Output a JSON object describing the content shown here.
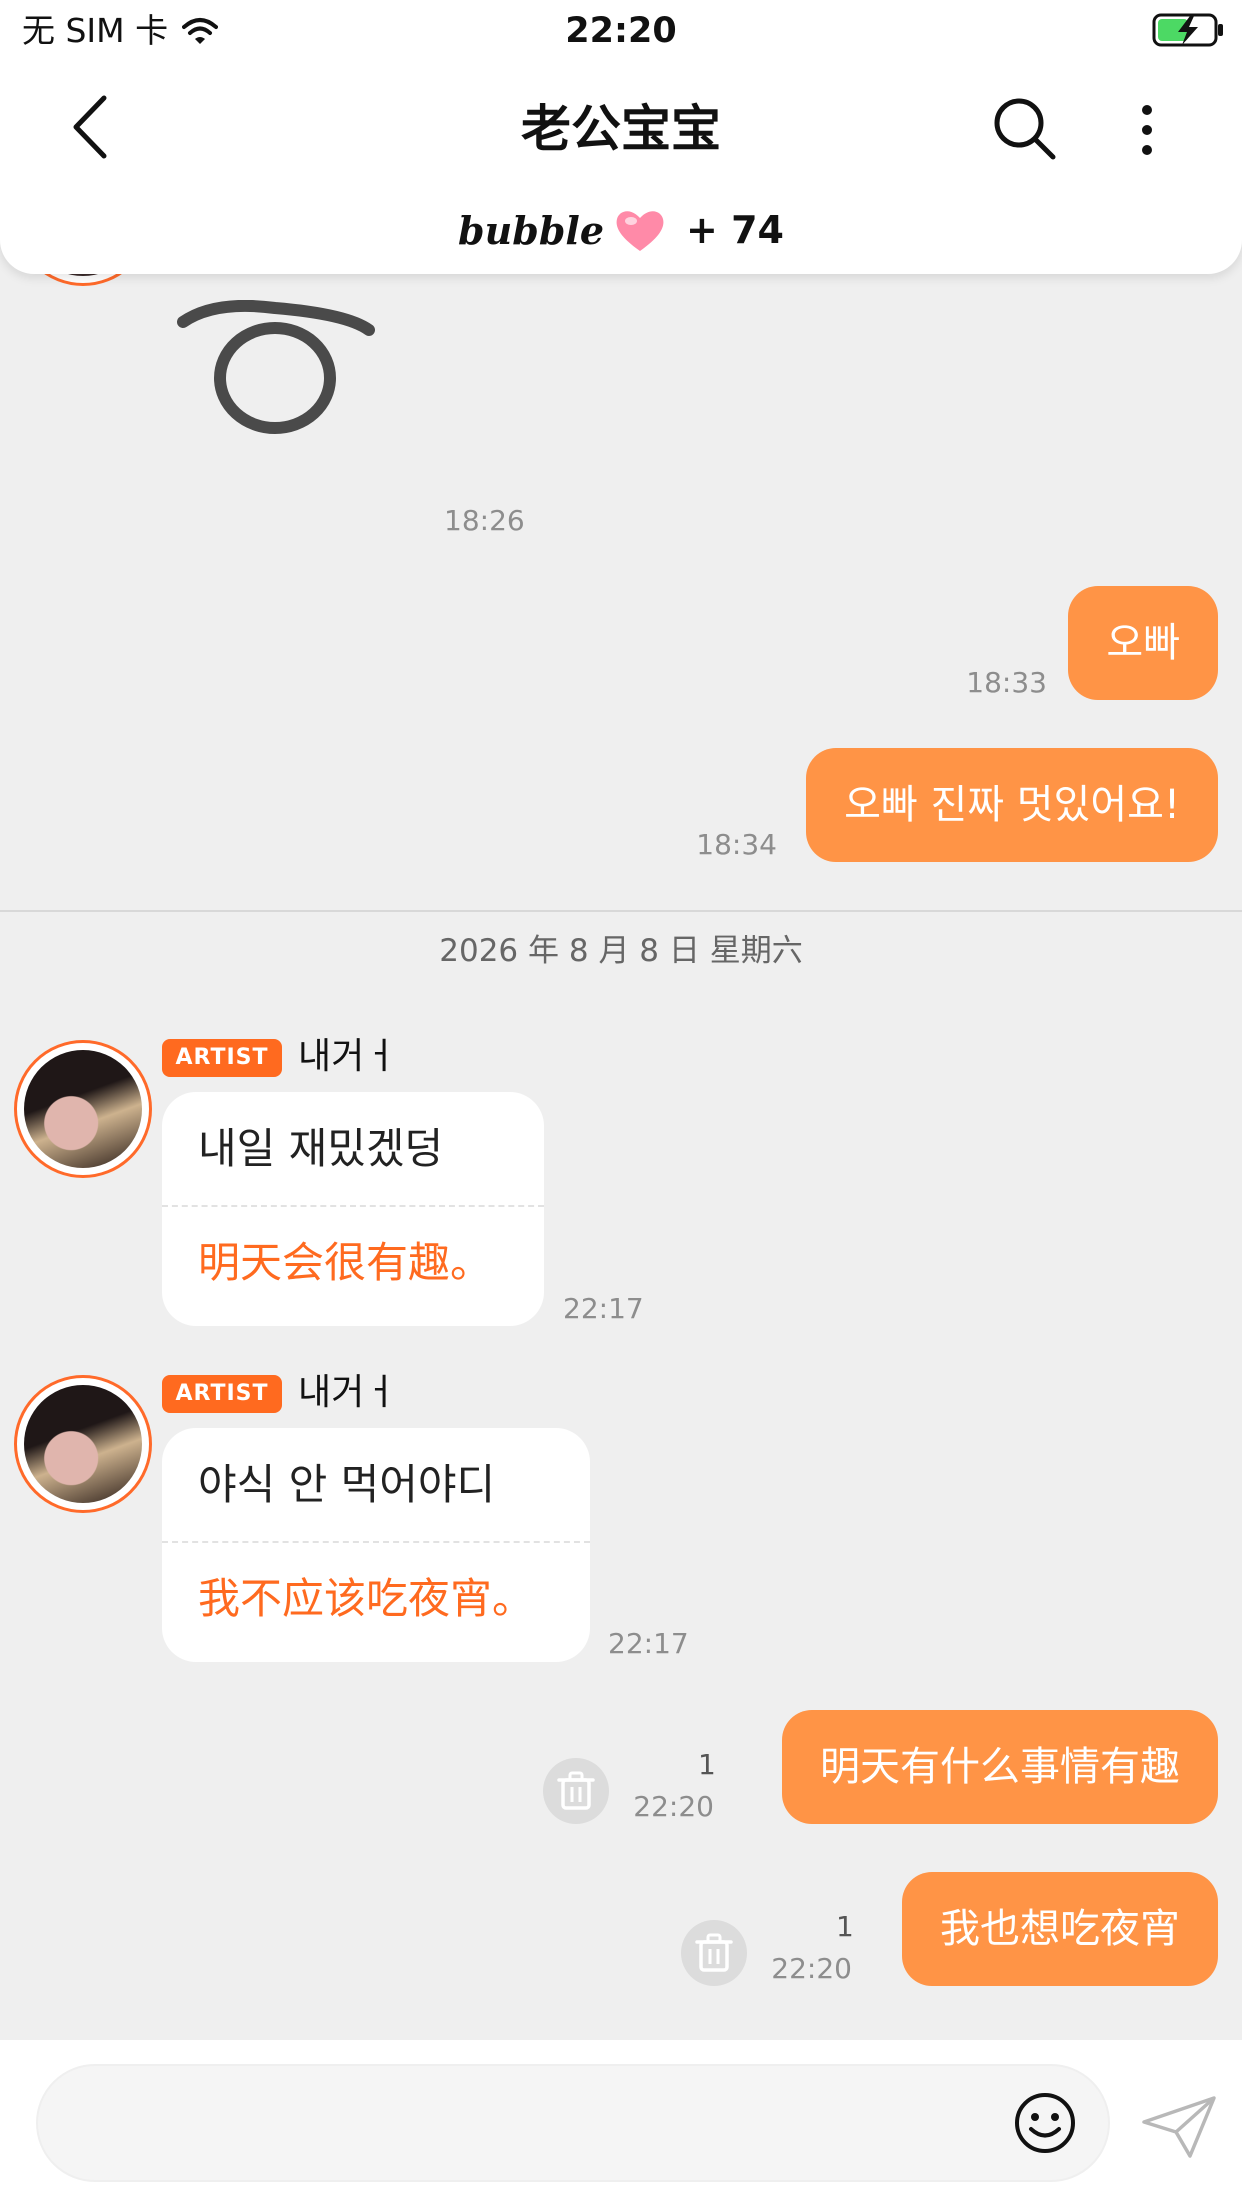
{
  "status_bar": {
    "carrier": "无 SIM 卡",
    "time": "22:20",
    "battery_color": "#4cd964"
  },
  "header": {
    "title": "老公宝宝",
    "bubble_label": "bubble",
    "bubble_count": "+ 74",
    "heart_color": "#ff8aa8"
  },
  "messages": {
    "sticker_time": "18:26",
    "outgoing_early": [
      {
        "text": "오빠",
        "time": "18:33"
      },
      {
        "text": "오빠 진짜 멋있어요!",
        "time": "18:34"
      }
    ],
    "date_divider": "2026 年 8 月 8 日 星期六",
    "incoming": [
      {
        "badge": "ARTIST",
        "sender": "내거ㅓ",
        "original": "내일 재밌겠덩",
        "translation": "明天会很有趣。",
        "time": "22:17"
      },
      {
        "badge": "ARTIST",
        "sender": "내거ㅓ",
        "original": "야식 안 먹어야디",
        "translation": "我不应该吃夜宵。",
        "time": "22:17"
      }
    ],
    "outgoing_late": [
      {
        "text": "明天有什么事情有趣",
        "time": "22:20",
        "unread": "1"
      },
      {
        "text": "我也想吃夜宵",
        "time": "22:20",
        "unread": "1"
      }
    ]
  },
  "composer": {
    "value": "",
    "placeholder": ""
  },
  "colors": {
    "accent": "#ff9446",
    "artist_badge": "#ff6a1f",
    "translation_text": "#ff6a1f",
    "background": "#efefef"
  }
}
